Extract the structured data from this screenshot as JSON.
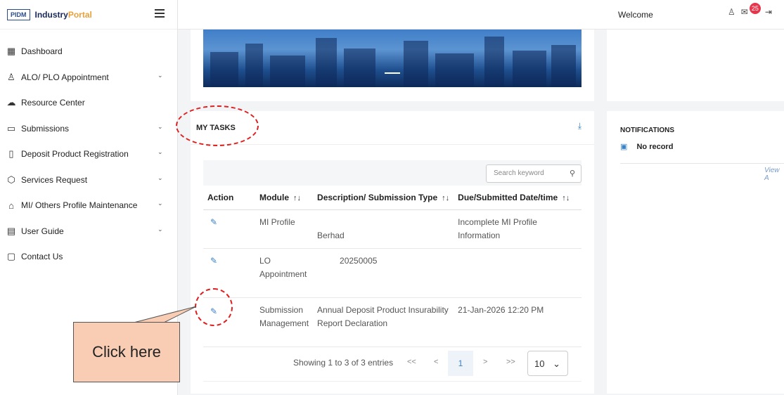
{
  "sidebar": {
    "logo": "PIDM",
    "brand_main": "Industry",
    "brand_accent": "Portal",
    "items": [
      {
        "label": "Dashboard",
        "icon": "grid-icon",
        "has_chevron": false
      },
      {
        "label": "ALO/ PLO Appointment",
        "icon": "user-add-icon",
        "has_chevron": true
      },
      {
        "label": "Resource Center",
        "icon": "cloud-upload-icon",
        "has_chevron": false
      },
      {
        "label": "Submissions",
        "icon": "folder-icon",
        "has_chevron": true
      },
      {
        "label": "Deposit Product Registration",
        "icon": "file-icon",
        "has_chevron": true
      },
      {
        "label": "Services Request",
        "icon": "cube-icon",
        "has_chevron": true
      },
      {
        "label": "MI/ Others Profile Maintenance",
        "icon": "bank-icon",
        "has_chevron": true
      },
      {
        "label": "User Guide",
        "icon": "book-icon",
        "has_chevron": true
      },
      {
        "label": "Contact Us",
        "icon": "chat-icon",
        "has_chevron": false
      }
    ]
  },
  "header": {
    "welcome": "Welcome",
    "mail_badge": "25"
  },
  "tasks": {
    "title": "MY TASKS",
    "search_placeholder": "Search keyword",
    "columns": [
      "Action",
      "Module",
      "Description/ Submission Type",
      "Due/Submitted Date/time"
    ],
    "rows": [
      {
        "module": "MI Profile",
        "description": "Berhad",
        "due": "Incomplete MI Profile Information"
      },
      {
        "module": "LO Appointment",
        "description": "20250005",
        "due": ""
      },
      {
        "module": "Submission Management",
        "description": "Annual Deposit Product Insurability Report Declaration",
        "due": "21-Jan-2026 12:20 PM"
      }
    ],
    "pagination": {
      "info": "Showing 1 to 3 of 3 entries",
      "first": "<<",
      "prev": "<",
      "current": "1",
      "next": ">",
      "last": ">>",
      "page_size": "10"
    }
  },
  "notifications": {
    "title": "NOTIFICATIONS",
    "empty": "No record",
    "view_all": "View A"
  },
  "annotation": {
    "callout_text": "Click here"
  },
  "colors": {
    "accent": "#3b82c4",
    "badge": "#e7354b",
    "annotation": "#e01e1e",
    "callout_bg": "#f8cdb4"
  }
}
